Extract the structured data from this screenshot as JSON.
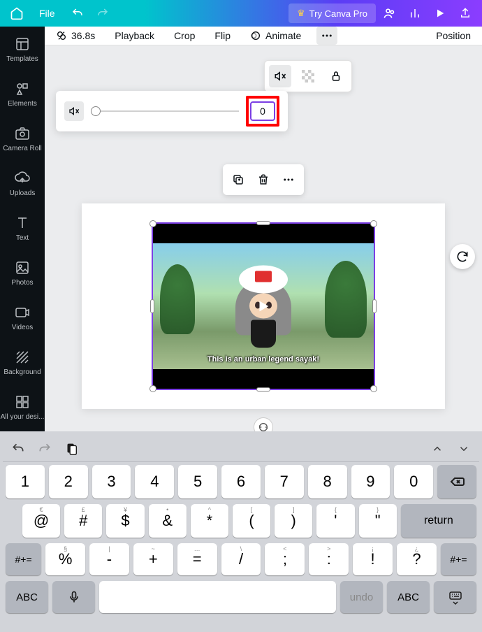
{
  "topbar": {
    "file_label": "File",
    "pro_label": "Try Canva Pro"
  },
  "sidebar": {
    "items": [
      {
        "label": "Templates"
      },
      {
        "label": "Elements"
      },
      {
        "label": "Camera Roll"
      },
      {
        "label": "Uploads"
      },
      {
        "label": "Text"
      },
      {
        "label": "Photos"
      },
      {
        "label": "Videos"
      },
      {
        "label": "Background"
      },
      {
        "label": "All your desi..."
      }
    ]
  },
  "toolbar": {
    "duration": "36.8s",
    "playback": "Playback",
    "crop": "Crop",
    "flip": "Flip",
    "animate": "Animate",
    "position": "Position"
  },
  "volume": {
    "value": "0"
  },
  "video": {
    "subtitle": "This is an urban legend sayak!"
  },
  "keyboard": {
    "row1": [
      "1",
      "2",
      "3",
      "4",
      "5",
      "6",
      "7",
      "8",
      "9",
      "0"
    ],
    "row2": [
      {
        "main": "@",
        "sup": "€"
      },
      {
        "main": "#",
        "sup": "£"
      },
      {
        "main": "$",
        "sup": "¥"
      },
      {
        "main": "&",
        "sup": "•"
      },
      {
        "main": "*",
        "sup": "^"
      },
      {
        "main": "(",
        "sup": "["
      },
      {
        "main": ")",
        "sup": "]"
      },
      {
        "main": "'",
        "sup": "{"
      },
      {
        "main": "\"",
        "sup": "}"
      }
    ],
    "row3_lead": "#+=",
    "row3": [
      {
        "main": "%",
        "sup": "§"
      },
      {
        "main": "-",
        "sup": "|"
      },
      {
        "main": "+",
        "sup": "~"
      },
      {
        "main": "=",
        "sup": "…"
      },
      {
        "main": "/",
        "sup": "\\"
      },
      {
        "main": ";",
        "sup": "<"
      },
      {
        "main": ":",
        "sup": ">"
      },
      {
        "main": "!",
        "sup": "¡"
      },
      {
        "main": "?",
        "sup": "¿"
      }
    ],
    "row3_trail": "#+=",
    "return": "return",
    "abc": "ABC",
    "undo": "undo"
  }
}
